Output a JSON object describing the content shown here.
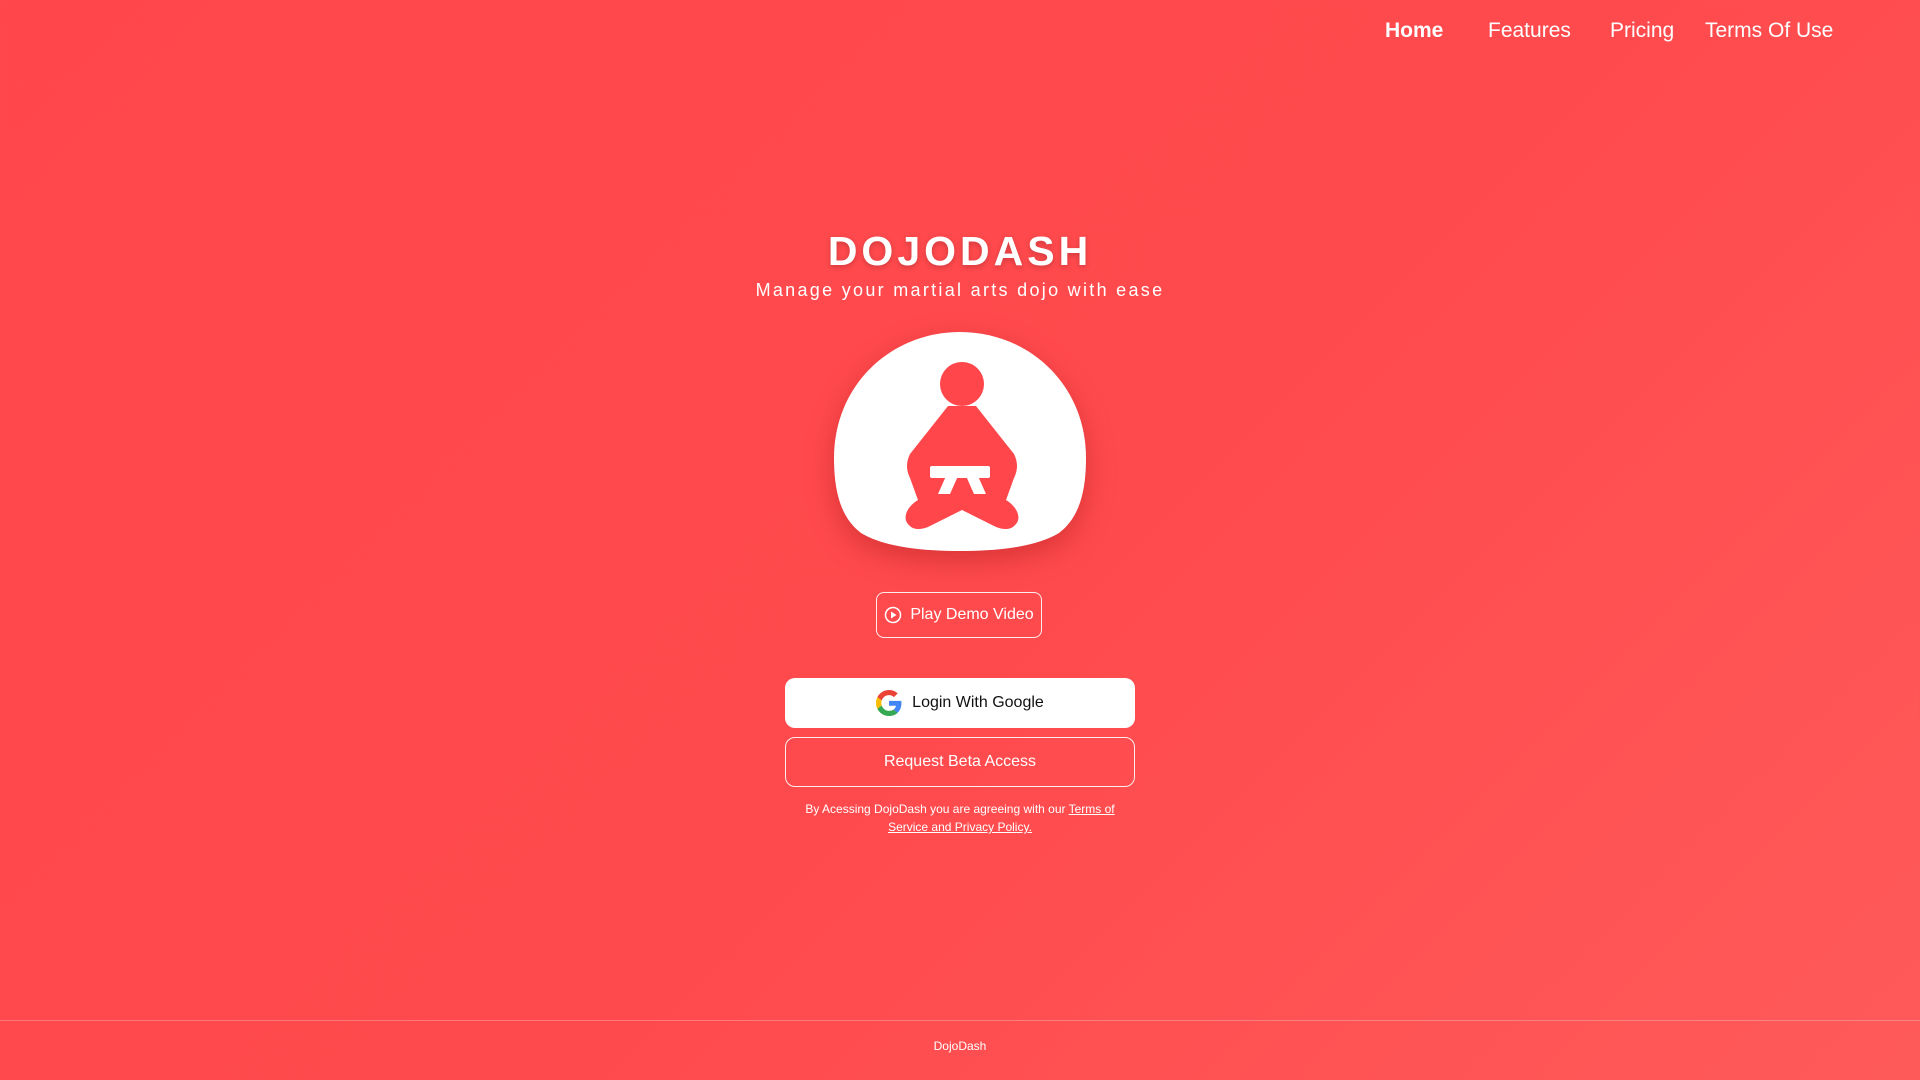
{
  "nav": {
    "items": [
      {
        "label": "Home",
        "active": true
      },
      {
        "label": "Features"
      },
      {
        "label": "Pricing"
      },
      {
        "label": "Terms Of Use"
      }
    ]
  },
  "hero": {
    "title": "DOJODASH",
    "subtitle": "Manage your martial arts dojo with ease",
    "logo_icon": "meditating-martial-artist-icon"
  },
  "actions": {
    "demo_label": "Play Demo Video",
    "demo_icon": "play-circle-icon",
    "google_label": "Login With Google",
    "google_icon": "google-icon",
    "beta_label": "Request Beta Access"
  },
  "legal": {
    "prefix": "By Acessing DojoDash you are agreeing with our ",
    "link_text": "Terms of Service and Privacy Policy."
  },
  "footer": {
    "text": "DojoDash"
  },
  "colors": {
    "background": "#ff474b",
    "accent": "#ff4a4d",
    "white": "#ffffff"
  }
}
